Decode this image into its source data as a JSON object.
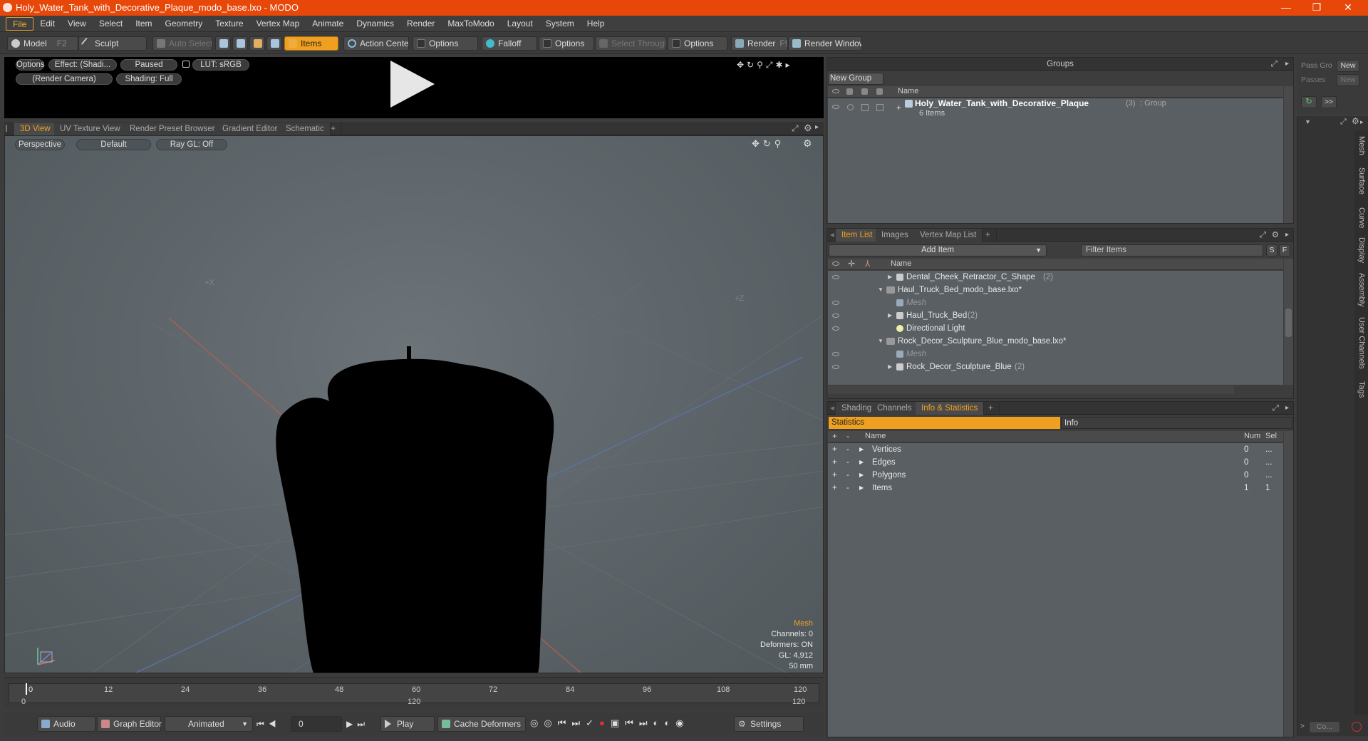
{
  "window": {
    "title": "Holy_Water_Tank_with_Decorative_Plaque_modo_base.lxo - MODO",
    "minimize": "—",
    "maximize": "❐",
    "close": "✕"
  },
  "menu": [
    "File",
    "Edit",
    "View",
    "Select",
    "Item",
    "Geometry",
    "Texture",
    "Vertex Map",
    "Animate",
    "Dynamics",
    "Render",
    "MaxToModo",
    "Layout",
    "System",
    "Help"
  ],
  "toolbar": {
    "model": "Model",
    "model_key": "F2",
    "sculpt": "Sculpt",
    "auto_select": "Auto Select",
    "items": "Items",
    "action_center": "Action Center",
    "options1": "Options",
    "falloff": "Falloff",
    "options2": "Options",
    "select_through": "Select Through",
    "options3": "Options",
    "render": "Render",
    "render_key": "F9",
    "render_window": "Render Window"
  },
  "preview": {
    "options": "Options",
    "effect": "Effect: (Shadi...",
    "paused": "Paused",
    "lut": "LUT: sRGB",
    "camera": "(Render Camera)",
    "shading": "Shading: Full"
  },
  "viewport_tabs": [
    "3D View",
    "UV Texture View",
    "Render Preset Browser",
    "Gradient Editor",
    "Schematic",
    "+"
  ],
  "viewport": {
    "perspective": "Perspective",
    "default": "Default",
    "raygl": "Ray GL: Off",
    "axis_x": "+X",
    "axis_z": "+Z",
    "hud_title": "Mesh",
    "hud_lines": [
      "Channels: 0",
      "Deformers: ON",
      "GL: 4,912",
      "50 mm"
    ]
  },
  "timeline": {
    "ticks": [
      "0",
      "12",
      "24",
      "36",
      "48",
      "60",
      "72",
      "84",
      "96",
      "108",
      "120"
    ],
    "lower_left": "0",
    "lower_mid": "120",
    "lower_right": "120"
  },
  "bottombar": {
    "audio": "Audio",
    "graph_editor": "Graph Editor",
    "animated": "Animated",
    "frame": "0",
    "play": "Play",
    "cache_deformers": "Cache Deformers",
    "settings": "Settings"
  },
  "groups": {
    "title": "Groups",
    "new_group": "New Group",
    "col_name": "Name",
    "group_name": "Holy_Water_Tank_with_Decorative_Plaque",
    "group_count": "(3)",
    "group_type": ": Group",
    "group_items": "6 Items"
  },
  "passes": {
    "pass_label": "Pass Gro",
    "pass_new": "New",
    "passes_label": "Passes",
    "passes_new": "New",
    "arrow_btn": ">>"
  },
  "itemlist": {
    "tabs": [
      "Item List",
      "Images",
      "Vertex Map List",
      "+"
    ],
    "add_item": "Add Item",
    "filter": "Filter Items",
    "btn_s": "S",
    "btn_f": "F",
    "col_name": "Name",
    "rows": [
      {
        "label": "Dental_Cheek_Retractor_C_Shape",
        "count": "(2)"
      },
      {
        "label": "Haul_Truck_Bed_modo_base.lxo*",
        "count": ""
      },
      {
        "label": "Mesh",
        "count": ""
      },
      {
        "label": "Haul_Truck_Bed",
        "count": "(2)"
      },
      {
        "label": "Directional Light",
        "count": ""
      },
      {
        "label": "Rock_Decor_Sculpture_Blue_modo_base.lxo*",
        "count": ""
      },
      {
        "label": "Mesh",
        "count": ""
      },
      {
        "label": "Rock_Decor_Sculpture_Blue",
        "count": "(2)"
      }
    ]
  },
  "stats": {
    "tabs": [
      "Shading",
      "Channels",
      "Info & Statistics",
      "+"
    ],
    "sub_statistics": "Statistics",
    "sub_info": "Info",
    "col_name": "Name",
    "col_num": "Num",
    "col_sel": "Sel",
    "rows": [
      {
        "name": "Vertices",
        "num": "0",
        "sel": "..."
      },
      {
        "name": "Edges",
        "num": "0",
        "sel": "..."
      },
      {
        "name": "Polygons",
        "num": "0",
        "sel": "..."
      },
      {
        "name": "Items",
        "num": "1",
        "sel": "1"
      }
    ]
  },
  "sidebar_tabs": [
    "Mesh",
    "Surface",
    "Curve",
    "Display",
    "Assembly",
    "User Channels",
    "Tags"
  ],
  "command": {
    "placeholder": "Co..."
  },
  "colors": {
    "accent": "#f0a020",
    "titlebar": "#e8470a"
  }
}
